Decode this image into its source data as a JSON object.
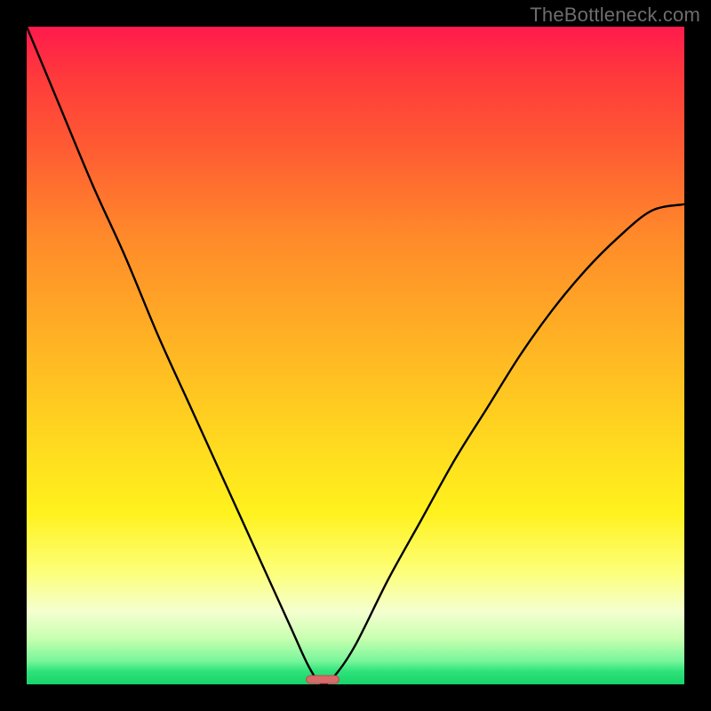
{
  "watermark": "TheBottleneck.com",
  "chart_data": {
    "type": "line",
    "title": "",
    "xlabel": "",
    "ylabel": "",
    "xlim": [
      0,
      1
    ],
    "ylim": [
      0,
      1
    ],
    "background_gradient": {
      "top": "#ff1a4d",
      "mid": "#ffe11f",
      "bottom": "#17d36a"
    },
    "series": [
      {
        "name": "curve",
        "x": [
          0.0,
          0.05,
          0.1,
          0.15,
          0.2,
          0.25,
          0.3,
          0.35,
          0.4,
          0.43,
          0.45,
          0.47,
          0.5,
          0.55,
          0.6,
          0.65,
          0.7,
          0.75,
          0.8,
          0.85,
          0.9,
          0.95,
          1.0
        ],
        "y": [
          1.0,
          0.88,
          0.76,
          0.65,
          0.53,
          0.42,
          0.31,
          0.2,
          0.09,
          0.025,
          0.0,
          0.015,
          0.06,
          0.16,
          0.25,
          0.34,
          0.42,
          0.5,
          0.57,
          0.63,
          0.68,
          0.72,
          0.73
        ]
      }
    ],
    "trough_marker": {
      "x_center": 0.45,
      "width": 0.05,
      "height": 0.012
    }
  }
}
